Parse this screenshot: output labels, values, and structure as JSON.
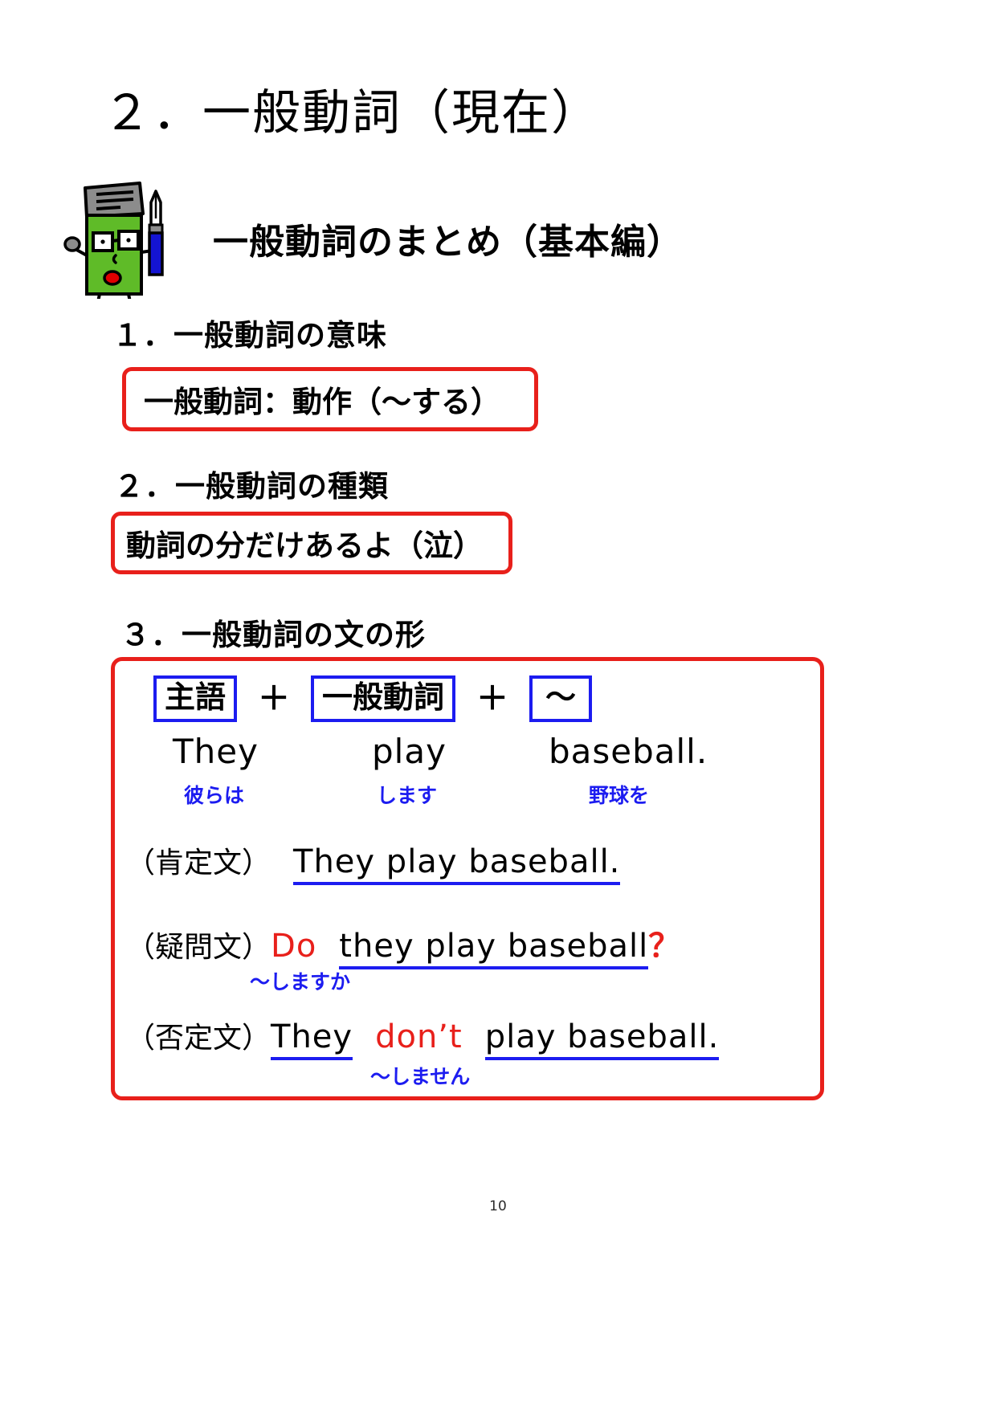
{
  "page": {
    "title": "２．一般動詞（現在）",
    "subtitle": "一般動詞のまとめ（基本編）",
    "page_number": "10",
    "colors": {
      "red": "#e8201b",
      "blue": "#1c1cf0",
      "mascot_green": "#5fbb28",
      "mascot_gray": "#8c8c8c",
      "mascot_mouth": "#e00000",
      "mascot_pen": "#1414d2"
    }
  },
  "mascot": {
    "icon_name": "book-character-with-pen-icon",
    "description": "green book character wearing glasses holding a blue fountain pen"
  },
  "sections": [
    {
      "heading": "１．一般動詞の意味",
      "box_text": "一般動詞：動作（〜する）"
    },
    {
      "heading": "２．一般動詞の種類",
      "box_text": "動詞の分だけあるよ（泣）"
    },
    {
      "heading": "３．一般動詞の文の形"
    }
  ],
  "formula": {
    "parts": [
      {
        "label": "主語"
      },
      {
        "label": "一般動詞"
      },
      {
        "label": "〜"
      }
    ],
    "operator": "＋"
  },
  "example": {
    "english": [
      "They",
      "play",
      "baseball."
    ],
    "glosses": [
      "彼らは",
      "します",
      "野球を"
    ]
  },
  "sentences": {
    "affirmative": {
      "label": "（肯定文）",
      "underlined": "They play baseball.",
      "gloss": ""
    },
    "question": {
      "label": "（疑問文）",
      "aux": "Do",
      "underlined": "they play baseball",
      "mark": "？",
      "gloss": "〜しますか"
    },
    "negative": {
      "label": "（否定文）",
      "subject": "They",
      "aux": "don’t",
      "rest": "play baseball.",
      "gloss": "〜しません"
    }
  }
}
